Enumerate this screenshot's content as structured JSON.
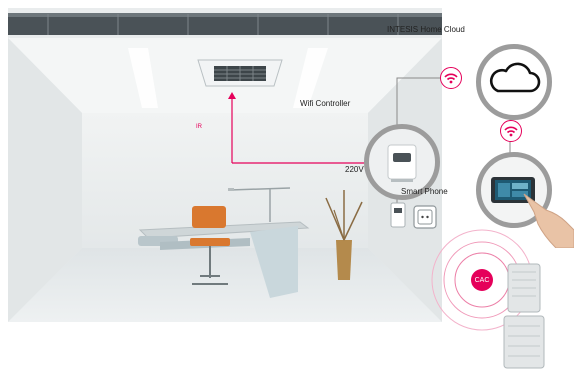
{
  "labels": {
    "cloud": "INTESIS Home Cloud",
    "wifi_controller": "Wifi Controller",
    "ir": "IR",
    "voltage": "220V",
    "smart_phone": "Smart Phone",
    "cac": "CAC"
  },
  "colors": {
    "accent": "#e5005a",
    "ring": "#9c9c9c",
    "line": "#8a8a8a",
    "room_wall": "#e9eced",
    "ceiling_bar": "#4a5257"
  },
  "icons": [
    "cloud-icon",
    "wifi-icon",
    "ceiling-cassette-unit",
    "wifi-controller-device",
    "power-socket-icon",
    "smartphone-icon",
    "cac-outdoor-unit"
  ]
}
